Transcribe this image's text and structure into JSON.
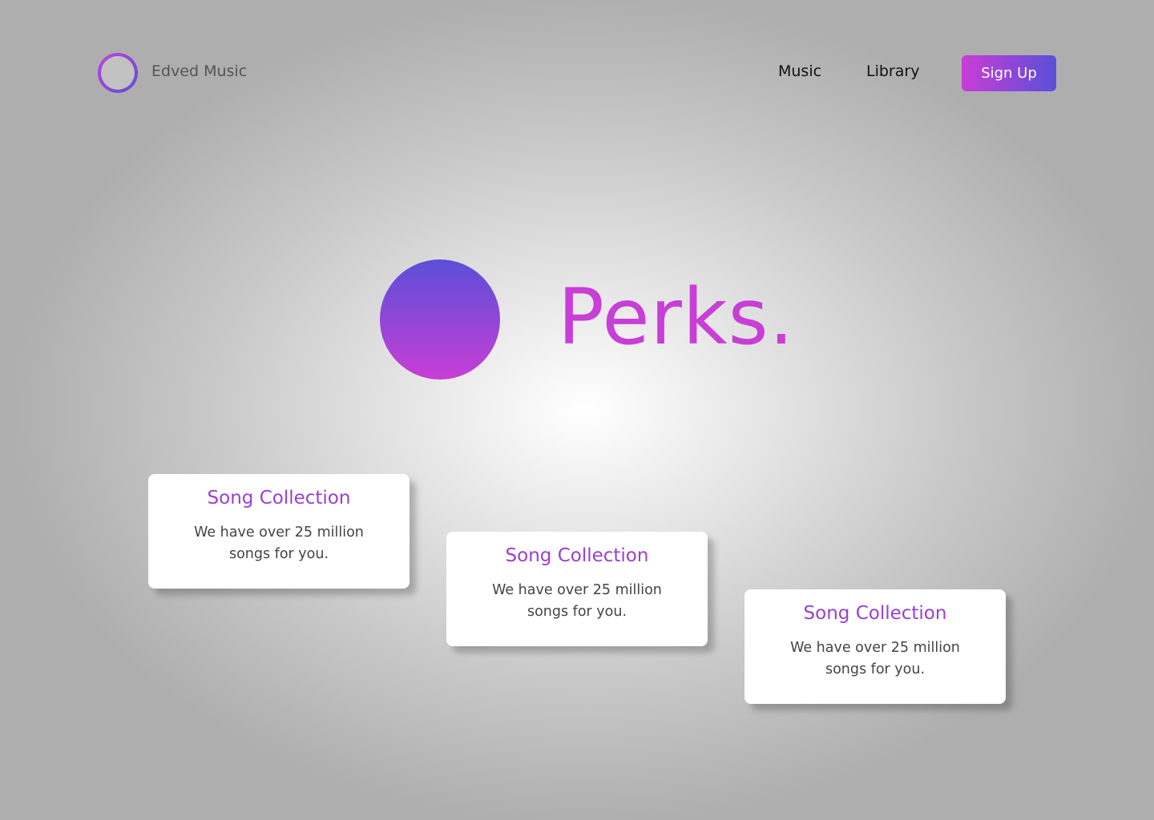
{
  "header": {
    "brand": "Edved Music",
    "nav": [
      {
        "label": "Music"
      },
      {
        "label": "Library"
      }
    ],
    "cta_label": "Sign Up"
  },
  "hero": {
    "headline": "Perks."
  },
  "cards": [
    {
      "title": "Song Collection",
      "text": "We have over 25 million songs for you."
    },
    {
      "title": "Song Collection",
      "text": "We have over 25 million songs for you."
    },
    {
      "title": "Song Collection",
      "text": "We have over 25 million songs for you."
    }
  ],
  "colors": {
    "accent_pink": "#c83ed6",
    "accent_blue": "#5a4fd8",
    "card_title": "#9a3fd2"
  },
  "icons": {
    "logo": "soundwave-icon"
  }
}
